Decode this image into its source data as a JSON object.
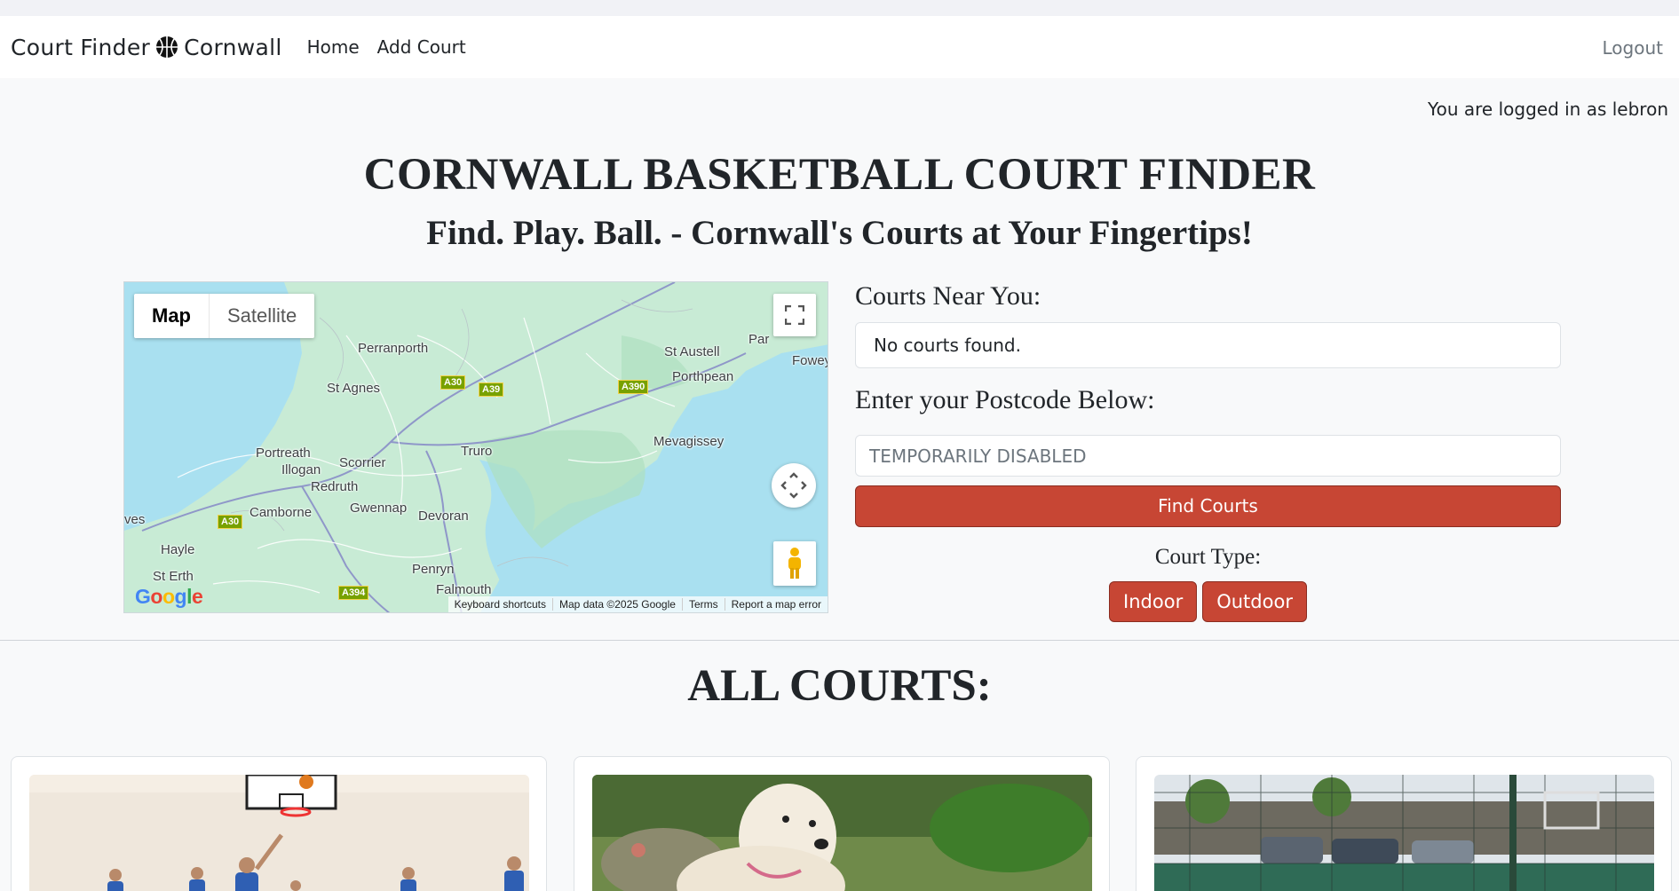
{
  "navbar": {
    "brand_left": "Court Finder",
    "brand_right": "Cornwall",
    "links": [
      "Home",
      "Add Court"
    ],
    "logout": "Logout"
  },
  "user": {
    "logged_in_text": "You are logged in as lebron"
  },
  "hero": {
    "title": "CORNWALL BASKETBALL COURT FINDER",
    "subtitle": "Find. Play. Ball. - Cornwall's Courts at Your Fingertips!"
  },
  "map": {
    "type_options": [
      "Map",
      "Satellite"
    ],
    "selected_type": "Map",
    "places": [
      "Perranporth",
      "St Agnes",
      "Portreath",
      "Illogan",
      "Scorrier",
      "Redruth",
      "Truro",
      "Gwennap",
      "Devoran",
      "Camborne",
      "Hayle",
      "St Erth",
      "Penryn",
      "Falmouth",
      "Mevagissey",
      "St Austell",
      "Porthpean",
      "Par",
      "Fowey",
      "ves"
    ],
    "roads": [
      "A30",
      "A39",
      "A390",
      "A30",
      "A394"
    ],
    "logo": "Google",
    "footer": [
      "Keyboard shortcuts",
      "Map data ©2025 Google",
      "Terms",
      "Report a map error"
    ]
  },
  "courts_near": {
    "title": "Courts Near You:",
    "result": "No courts found."
  },
  "postcode": {
    "title": "Enter your Postcode Below:",
    "placeholder": "TEMPORARILY DISABLED",
    "button": "Find Courts"
  },
  "court_type": {
    "label": "Court Type:",
    "options": [
      "Indoor",
      "Outdoor"
    ]
  },
  "all_courts": {
    "title": "ALL COURTS:",
    "cards": [
      {
        "image": "indoor-basketball-game-photo"
      },
      {
        "image": "white-dog-photo"
      },
      {
        "image": "outdoor-court-photo"
      }
    ]
  },
  "colors": {
    "accent": "#c74634",
    "map_water": "#a9e0f0",
    "map_land": "#c8ebd5"
  }
}
